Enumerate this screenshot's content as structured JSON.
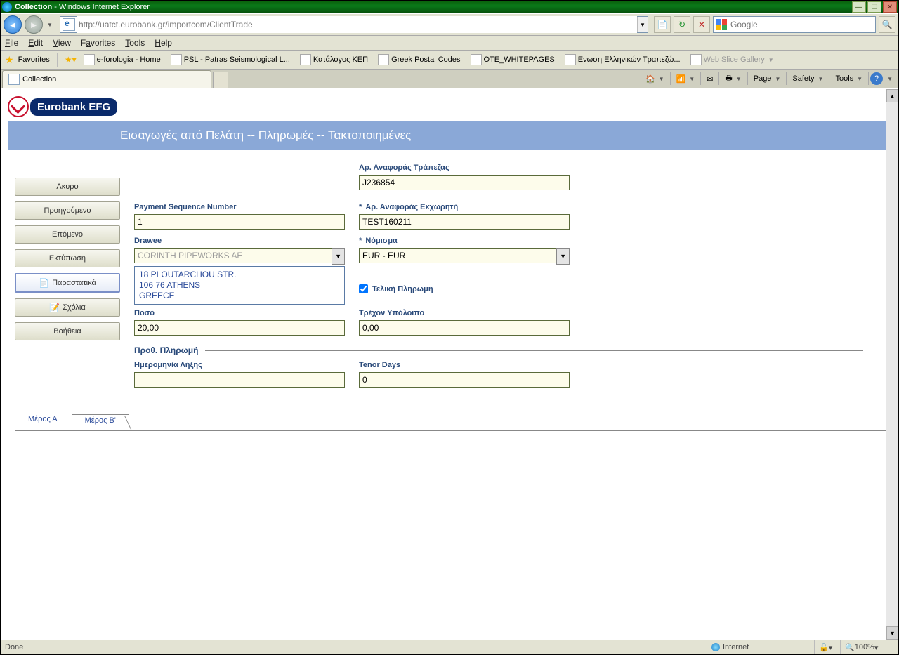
{
  "window": {
    "title_app": "Collection",
    "title_suffix": "Windows Internet Explorer"
  },
  "addressbar": {
    "url": "http://uatct.eurobank.gr/importcom/ClientTrade"
  },
  "searchbox": {
    "placeholder": "Google"
  },
  "menus": {
    "file": "File",
    "edit": "Edit",
    "view": "View",
    "favorites": "Favorites",
    "tools": "Tools",
    "help": "Help"
  },
  "favbar": {
    "label": "Favorites",
    "items": [
      {
        "label": "e-forologia - Home"
      },
      {
        "label": "PSL - Patras Seismological L..."
      },
      {
        "label": "Κατάλογος ΚΕΠ"
      },
      {
        "label": "Greek Postal Codes"
      },
      {
        "label": "OTE_WHITEPAGES"
      },
      {
        "label": "Ενωση Ελληνικών Τραπεζώ..."
      },
      {
        "label": "Web Slice Gallery"
      }
    ]
  },
  "browsertab": {
    "label": "Collection"
  },
  "cmdbar": {
    "page": "Page",
    "safety": "Safety",
    "tools": "Tools"
  },
  "brand": "Eurobank EFG",
  "banner_title": "Εισαγωγές από Πελάτη -- Πληρωμές -- Τακτοποιημένες",
  "left_buttons": {
    "cancel": "Ακυρο",
    "prev": "Προηγούμενο",
    "next": "Επόμενο",
    "print": "Εκτύπωση",
    "docs": "Παραστατικά",
    "comments": "Σχόλια",
    "help": "Βοήθεια"
  },
  "form": {
    "bank_ref_label": "Αρ. Αναφοράς Τράπεζας",
    "bank_ref": "J236854",
    "seq_label": "Payment Sequence Number",
    "seq": "1",
    "assignor_ref_label": "Αρ. Αναφοράς Εκχωρητή",
    "assignor_ref": "TEST160211",
    "drawee_label": "Drawee",
    "drawee": "CORINTH PIPEWORKS AE",
    "address_line1": "18 PLOUTARCHOU STR.",
    "address_line2": "106 76 ATHENS",
    "address_line3": "GREECE",
    "currency_label": "Νόμισμα",
    "currency": "EUR - EUR",
    "final_payment_label": "Τελική Πληρωμή",
    "final_payment_checked": true,
    "amount_label": "Ποσό",
    "amount": "20,00",
    "balance_label": "Τρέχον Υπόλοιπο",
    "balance": "0,00",
    "section_head": "Προθ. Πληρωμή",
    "expiry_label": "Ημερομηνία Λήξης",
    "expiry": "",
    "tenor_label": "Tenor Days",
    "tenor": "0"
  },
  "bottom_tabs": {
    "tab_a": "Μέρος Α'",
    "tab_b": "Μέρος Β'"
  },
  "statusbar": {
    "left": "Done",
    "zone": "Internet",
    "zoom": "100%"
  }
}
